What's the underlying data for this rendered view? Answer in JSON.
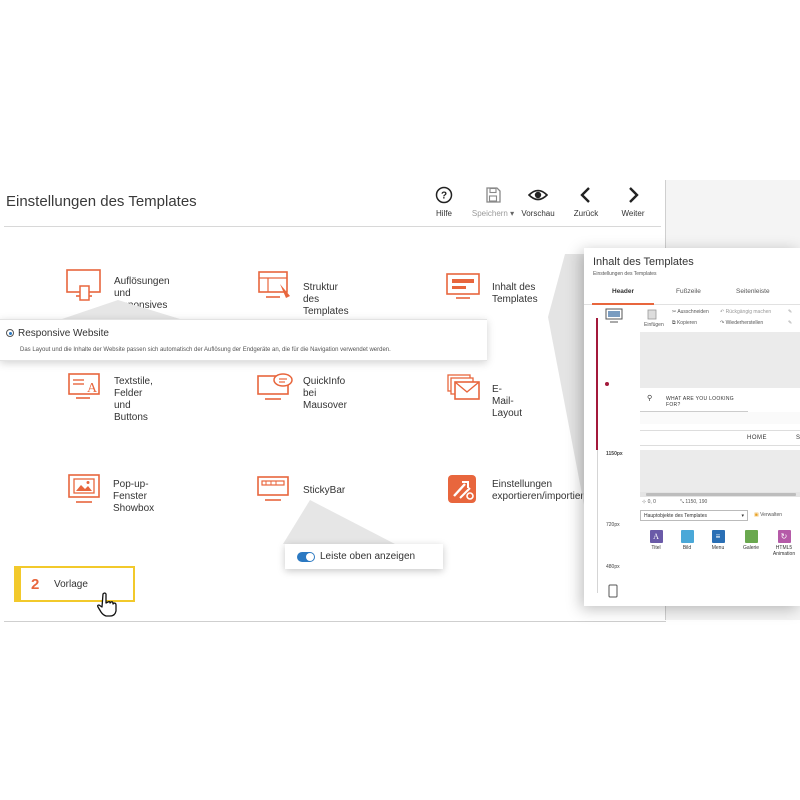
{
  "header": {
    "title": "Einstellungen des Templates",
    "toolbar": {
      "help": "Hilfe",
      "save": "Speichern",
      "preview": "Vorschau",
      "back": "Zurück",
      "next": "Weiter"
    }
  },
  "features": [
    {
      "label": "Auflösungen und\nresponsives Design",
      "icon": "responsive-devices-icon"
    },
    {
      "label": "Struktur des Templates",
      "icon": "template-structure-icon"
    },
    {
      "label": "Inhalt des Templates",
      "icon": "template-content-icon"
    },
    {
      "label": "Textstile,\nFelder und Buttons",
      "icon": "text-styles-icon"
    },
    {
      "label": "QuickInfo\nbei Mausover",
      "icon": "quickinfo-icon"
    },
    {
      "label": "E-Mail-Layout",
      "icon": "email-layout-icon"
    },
    {
      "label": "Pop-up-Fenster\nShowbox",
      "icon": "popup-window-icon"
    },
    {
      "label": "StickyBar",
      "icon": "stickybar-icon"
    },
    {
      "label": "Einstellungen\nexportieren/importieren",
      "icon": "export-import-icon"
    }
  ],
  "responsive_tooltip": {
    "title": "Responsive Website",
    "description": "Das Layout und die Inhalte der Website passen sich automatisch der Auflösung der Endgeräte an, die für die Navigation verwendet werden."
  },
  "sticky_popup": {
    "label": "Leiste oben anzeigen",
    "enabled": true
  },
  "step_badge": {
    "number": "2",
    "label": "Vorlage"
  },
  "content_panel": {
    "title": "Inhalt des Templates",
    "subtitle": "Einstellungen des Templates",
    "tabs": [
      "Header",
      "Fußzeile",
      "Seitenleiste"
    ],
    "active_tab": "Header",
    "buttons": {
      "paste": "Einfügen",
      "cut": "Ausschneiden",
      "copy": "Kopieren",
      "undo": "Rückgängig machen",
      "redo": "Wiederherstellen"
    },
    "breakpoints": [
      "1150px",
      "720px",
      "480px"
    ],
    "search_placeholder": "WHAT ARE YOU LOOKING FOR?",
    "nav_items": [
      "HOME",
      "S"
    ],
    "coords": {
      "position": "0, 0",
      "size": "1150, 190"
    },
    "object_select": "Hauptobjekte des Templates",
    "manage": "Verwalten",
    "tools": [
      {
        "label": "Titel",
        "color": "#6a5aa8"
      },
      {
        "label": "Bild",
        "color": "#4aa8d8"
      },
      {
        "label": "Menu",
        "color": "#2a6fb5"
      },
      {
        "label": "Galerie",
        "color": "#6aa84f"
      },
      {
        "label": "HTML5\nAnimation",
        "color": "#b55aa8"
      }
    ]
  },
  "colors": {
    "accent": "#e8663d",
    "blue": "#2b79c2",
    "highlight": "#f2c92b",
    "timeline": "#a3193b"
  }
}
